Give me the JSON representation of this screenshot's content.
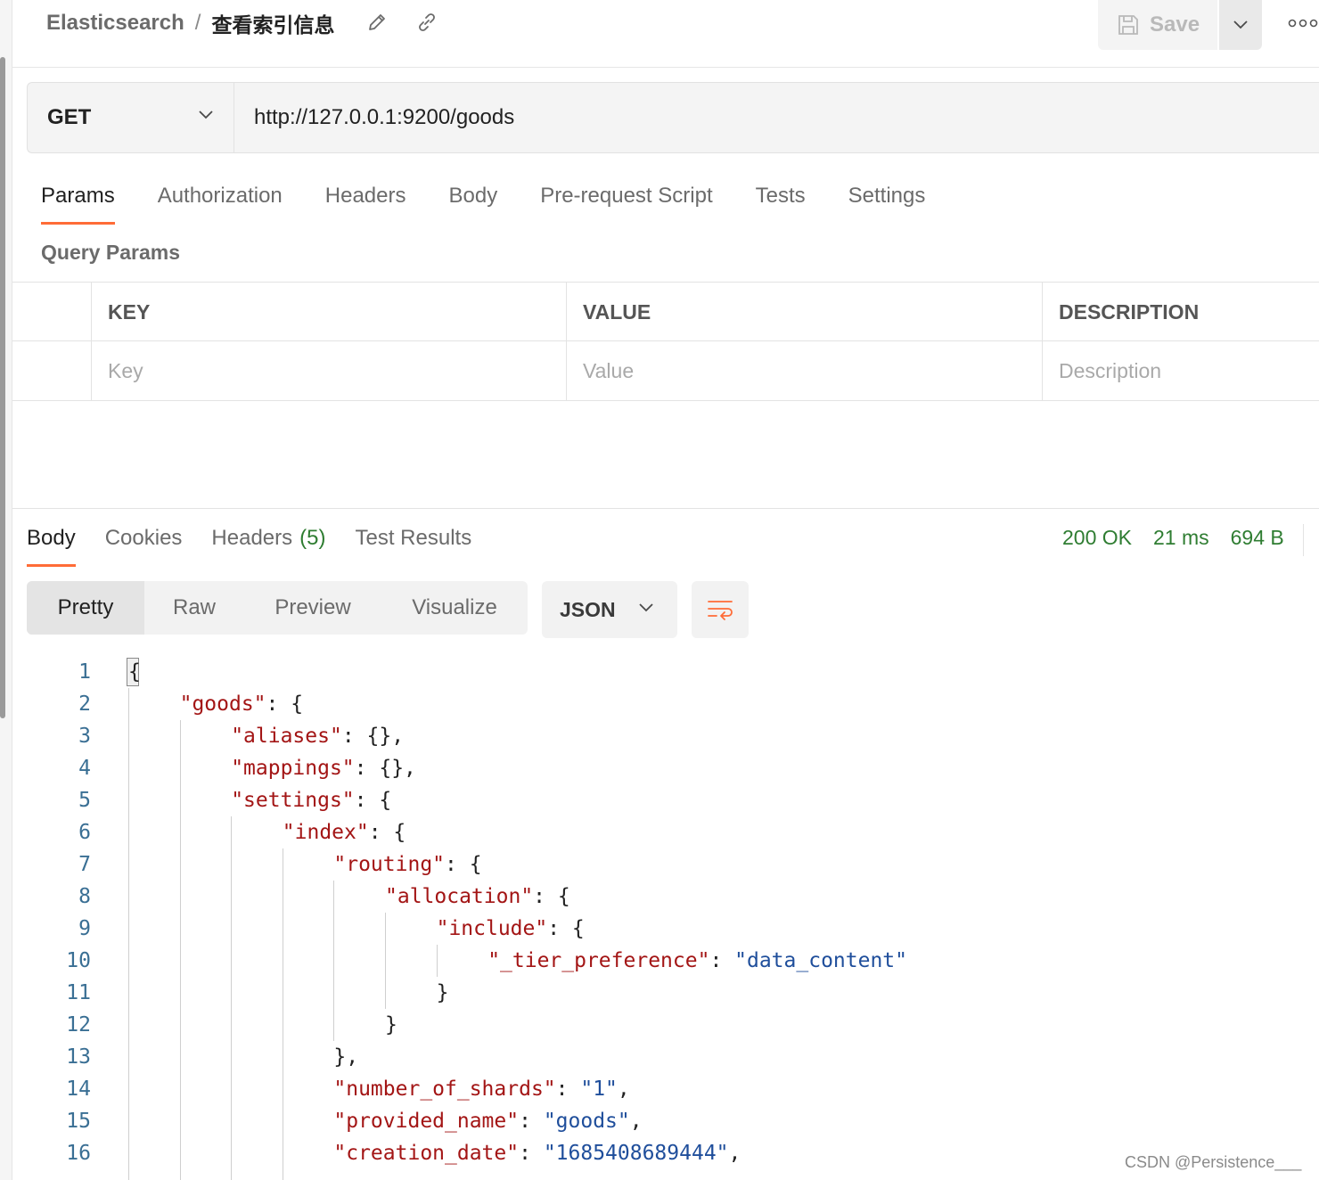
{
  "header": {
    "breadcrumb_parent": "Elasticsearch",
    "breadcrumb_sep": "/",
    "breadcrumb_current": "查看索引信息",
    "save_label": "Save"
  },
  "request": {
    "method": "GET",
    "url": "http://127.0.0.1:9200/goods",
    "tabs": [
      "Params",
      "Authorization",
      "Headers",
      "Body",
      "Pre-request Script",
      "Tests",
      "Settings"
    ],
    "active_tab": "Params",
    "section_label": "Query Params",
    "columns": [
      "KEY",
      "VALUE",
      "DESCRIPTION"
    ],
    "placeholders": [
      "Key",
      "Value",
      "Description"
    ]
  },
  "response": {
    "tabs": [
      {
        "label": "Body",
        "count": ""
      },
      {
        "label": "Cookies",
        "count": ""
      },
      {
        "label": "Headers",
        "count": "(5)"
      },
      {
        "label": "Test Results",
        "count": ""
      }
    ],
    "active_tab": "Body",
    "status": "200 OK",
    "time": "21 ms",
    "size": "694 B",
    "view_modes": [
      "Pretty",
      "Raw",
      "Preview",
      "Visualize"
    ],
    "active_view": "Pretty",
    "format": "JSON",
    "code_lines": [
      {
        "n": "1",
        "indent": 0,
        "parts": [
          [
            "p",
            "{"
          ]
        ]
      },
      {
        "n": "2",
        "indent": 1,
        "parts": [
          [
            "k",
            "\"goods\""
          ],
          [
            "p",
            ": {"
          ]
        ]
      },
      {
        "n": "3",
        "indent": 2,
        "parts": [
          [
            "k",
            "\"aliases\""
          ],
          [
            "p",
            ": {},"
          ]
        ]
      },
      {
        "n": "4",
        "indent": 2,
        "parts": [
          [
            "k",
            "\"mappings\""
          ],
          [
            "p",
            ": {},"
          ]
        ]
      },
      {
        "n": "5",
        "indent": 2,
        "parts": [
          [
            "k",
            "\"settings\""
          ],
          [
            "p",
            ": {"
          ]
        ]
      },
      {
        "n": "6",
        "indent": 3,
        "parts": [
          [
            "k",
            "\"index\""
          ],
          [
            "p",
            ": {"
          ]
        ]
      },
      {
        "n": "7",
        "indent": 4,
        "parts": [
          [
            "k",
            "\"routing\""
          ],
          [
            "p",
            ": {"
          ]
        ]
      },
      {
        "n": "8",
        "indent": 5,
        "parts": [
          [
            "k",
            "\"allocation\""
          ],
          [
            "p",
            ": {"
          ]
        ]
      },
      {
        "n": "9",
        "indent": 6,
        "parts": [
          [
            "k",
            "\"include\""
          ],
          [
            "p",
            ": {"
          ]
        ]
      },
      {
        "n": "10",
        "indent": 7,
        "parts": [
          [
            "k",
            "\"_tier_preference\""
          ],
          [
            "p",
            ": "
          ],
          [
            "s",
            "\"data_content\""
          ]
        ]
      },
      {
        "n": "11",
        "indent": 6,
        "parts": [
          [
            "p",
            "}"
          ]
        ]
      },
      {
        "n": "12",
        "indent": 5,
        "parts": [
          [
            "p",
            "}"
          ]
        ]
      },
      {
        "n": "13",
        "indent": 4,
        "parts": [
          [
            "p",
            "},"
          ]
        ]
      },
      {
        "n": "14",
        "indent": 4,
        "parts": [
          [
            "k",
            "\"number_of_shards\""
          ],
          [
            "p",
            ": "
          ],
          [
            "s",
            "\"1\""
          ],
          [
            "p",
            ","
          ]
        ]
      },
      {
        "n": "15",
        "indent": 4,
        "parts": [
          [
            "k",
            "\"provided_name\""
          ],
          [
            "p",
            ": "
          ],
          [
            "s",
            "\"goods\""
          ],
          [
            "p",
            ","
          ]
        ]
      },
      {
        "n": "16",
        "indent": 4,
        "parts": [
          [
            "k",
            "\"creation_date\""
          ],
          [
            "p",
            ": "
          ],
          [
            "s",
            "\"1685408689444\""
          ],
          [
            "p",
            ","
          ]
        ]
      }
    ]
  },
  "watermark": "CSDN @Persistence___",
  "colors": {
    "accent": "#ff6c37",
    "status_green": "#2f7d32",
    "json_key": "#a31515",
    "json_string": "#1f4e9b"
  },
  "icons": [
    "pencil-icon",
    "link-icon",
    "save-icon",
    "chevron-down-icon",
    "more-icon",
    "wrap-lines-icon"
  ]
}
